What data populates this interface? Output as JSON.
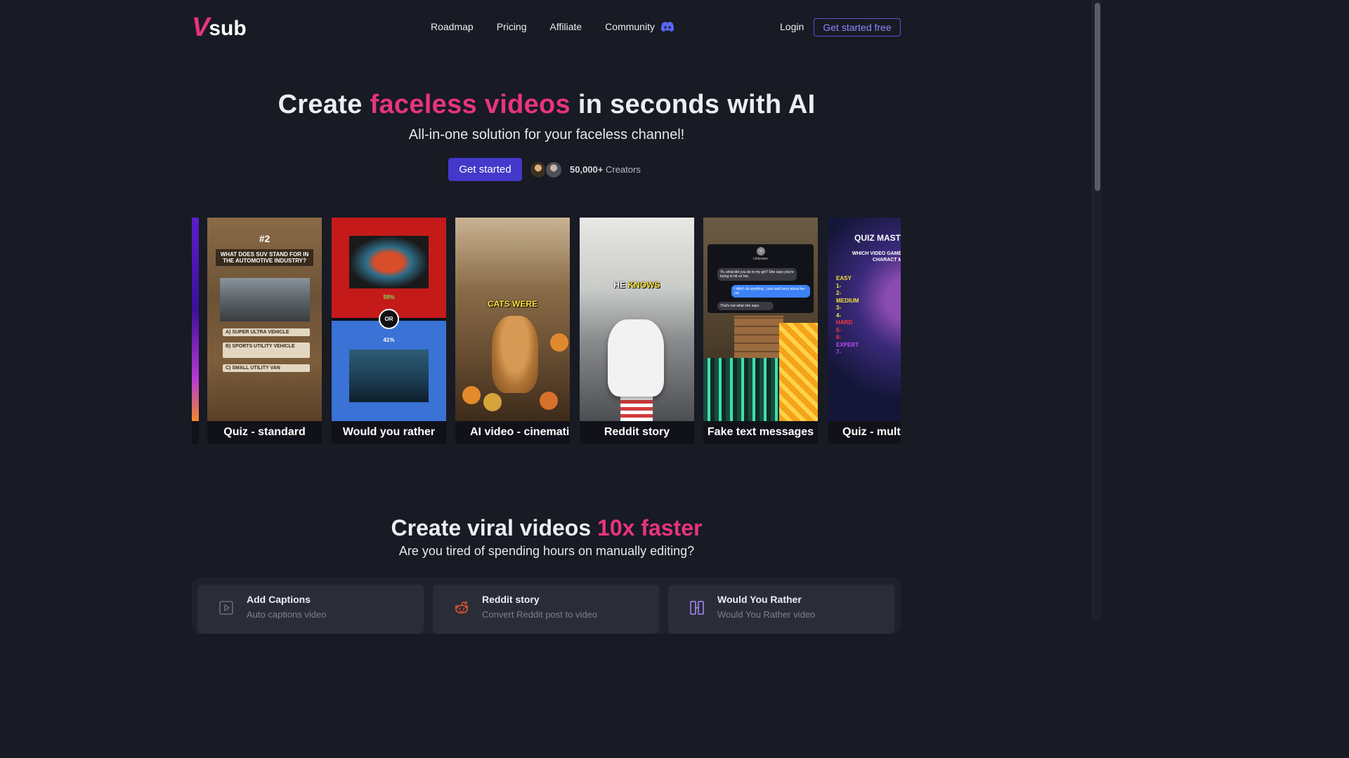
{
  "brand": {
    "logo_v": "V",
    "logo_text": "sub",
    "accent_color": "#e8347c",
    "primary_color": "#4338ca"
  },
  "nav": {
    "links": [
      "Roadmap",
      "Pricing",
      "Affiliate",
      "Community"
    ],
    "community_icon": "discord-icon",
    "login": "Login",
    "cta": "Get started free"
  },
  "hero": {
    "title_pre": "Create ",
    "title_accent": "faceless videos",
    "title_post": " in seconds with AI",
    "subtitle": "All-in-one solution for your faceless channel!",
    "cta": "Get started",
    "creators_count": "50,000+",
    "creators_label": "Creators"
  },
  "carousel": {
    "cards": [
      {
        "label": ""
      },
      {
        "label": "Quiz - standard",
        "num": "#2",
        "question": "WHAT DOES SUV STAND FOR IN THE AUTOMOTIVE INDUSTRY?",
        "options": [
          "A) SUPER ULTRA VEHICLE",
          "B) SPORTS UTILITY VEHICLE",
          "C) SMALL UTILITY VAN"
        ]
      },
      {
        "label": "Would you rather",
        "pct_a": "59%",
        "pct_b": "41%",
        "or": "OR"
      },
      {
        "label": "AI video - cinematic",
        "overlay": "CATS WERE"
      },
      {
        "label": "Reddit story",
        "overlay_white": "HE",
        "overlay_yellow": "KNOWS"
      },
      {
        "label": "Fake text messages",
        "contact": "Unknown",
        "messages": [
          "Yo, what did you do to my girl? She says you're trying to hit on her.",
          "I didn't do anything, I just said sorry about her cat.",
          "That's not what she says."
        ]
      },
      {
        "label": "Quiz - multil",
        "title": "QUIZ MAST",
        "question": "WHICH VIDEO GAME F FEATURES A CHARACT MARIO?",
        "levels": [
          "EASY",
          "1-",
          "2-",
          "MEDIUM",
          "3-",
          "4-",
          "HARD",
          "5-",
          "6-",
          "EXPERT",
          "7-"
        ]
      }
    ]
  },
  "section2": {
    "title_pre": "Create viral videos ",
    "title_accent": "10x faster",
    "subtitle": "Are you tired of spending hours on manually editing?",
    "features": [
      {
        "title": "Add Captions",
        "desc": "Auto captions video",
        "icon": "play-square-icon"
      },
      {
        "title": "Reddit story",
        "desc": "Convert Reddit post to video",
        "icon": "reddit-icon"
      },
      {
        "title": "Would You Rather",
        "desc": "Would You Rather video",
        "icon": "split-columns-icon"
      }
    ]
  }
}
